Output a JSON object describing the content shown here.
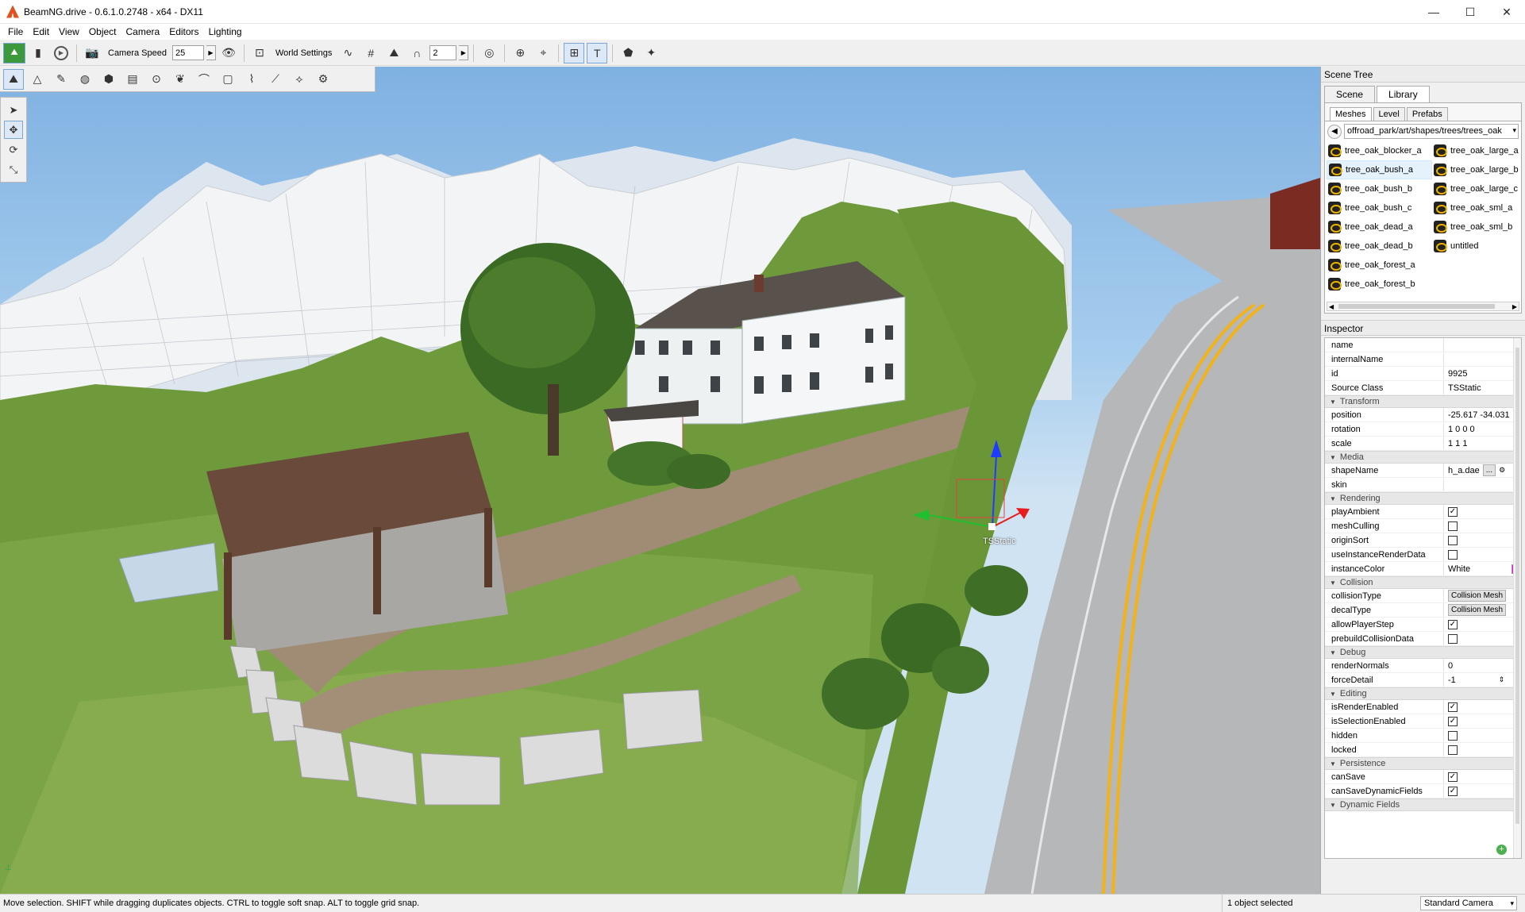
{
  "window": {
    "title": "BeamNG.drive - 0.6.1.0.2748 - x64 - DX11",
    "controls": [
      "—",
      "☐",
      "✕"
    ]
  },
  "menu": [
    "File",
    "Edit",
    "View",
    "Object",
    "Camera",
    "Editors",
    "Lighting"
  ],
  "toolbar": {
    "camera_speed_label": "Camera Speed",
    "camera_speed_value": "25",
    "world_settings_label": "World Settings",
    "grid_value": "2"
  },
  "scene_tree": {
    "title": "Scene Tree",
    "tabs": [
      "Scene",
      "Library"
    ],
    "active_tab": "Library",
    "subtabs": [
      "Meshes",
      "Level",
      "Prefabs"
    ],
    "path": "offroad_park/art/shapes/trees/trees_oak",
    "meshes_col1": [
      "tree_oak_blocker_a",
      "tree_oak_bush_a",
      "tree_oak_bush_b",
      "tree_oak_bush_c",
      "tree_oak_dead_a",
      "tree_oak_dead_b",
      "tree_oak_forest_a",
      "tree_oak_forest_b"
    ],
    "meshes_col2": [
      "tree_oak_large_a",
      "tree_oak_large_b",
      "tree_oak_large_c",
      "tree_oak_sml_a",
      "tree_oak_sml_b",
      "untitled"
    ],
    "selected_mesh": "tree_oak_bush_a"
  },
  "inspector": {
    "title": "Inspector",
    "general": [
      {
        "k": "name",
        "v": ""
      },
      {
        "k": "internalName",
        "v": ""
      },
      {
        "k": "id",
        "v": "9925"
      },
      {
        "k": "Source Class",
        "v": "TSStatic"
      }
    ],
    "groups": {
      "transform": "Transform",
      "media": "Media",
      "rendering": "Rendering",
      "collision": "Collision",
      "debug": "Debug",
      "editing": "Editing",
      "persistence": "Persistence",
      "dynamic": "Dynamic Fields"
    },
    "transform": [
      {
        "k": "position",
        "v": "-25.617 -34.031"
      },
      {
        "k": "rotation",
        "v": "1 0 0 0"
      },
      {
        "k": "scale",
        "v": "1 1 1"
      }
    ],
    "media": {
      "shapeName_label": "shapeName",
      "shapeName_value": "h_a.dae",
      "skin_label": "skin"
    },
    "rendering": {
      "playAmbient": "playAmbient",
      "meshCulling": "meshCulling",
      "originSort": "originSort",
      "useInstanceRenderData": "useInstanceRenderData",
      "instanceColor_label": "instanceColor",
      "instanceColor_value": "White",
      "instanceColor_swatch": "#ff00ff"
    },
    "collision": {
      "collisionType_label": "collisionType",
      "collisionType_value": "Collision Mesh",
      "decalType_label": "decalType",
      "decalType_value": "Collision Mesh",
      "allowPlayerStep": "allowPlayerStep",
      "prebuildCollisionData": "prebuildCollisionData"
    },
    "debug": {
      "renderNormals_label": "renderNormals",
      "renderNormals_value": "0",
      "forceDetail_label": "forceDetail",
      "forceDetail_value": "-1"
    },
    "editing": {
      "isRenderEnabled": "isRenderEnabled",
      "isSelectionEnabled": "isSelectionEnabled",
      "hidden": "hidden",
      "locked": "locked"
    },
    "persistence": {
      "canSave": "canSave",
      "canSaveDynamicFields": "canSaveDynamicFields"
    },
    "checked": "✓"
  },
  "viewport": {
    "gizmo_label": "TSStatic"
  },
  "statusbar": {
    "message": "Move selection.  SHIFT while dragging duplicates objects.  CTRL to toggle soft snap.  ALT to toggle grid snap.",
    "selection": "1 object selected",
    "camera_mode": "Standard Camera"
  }
}
